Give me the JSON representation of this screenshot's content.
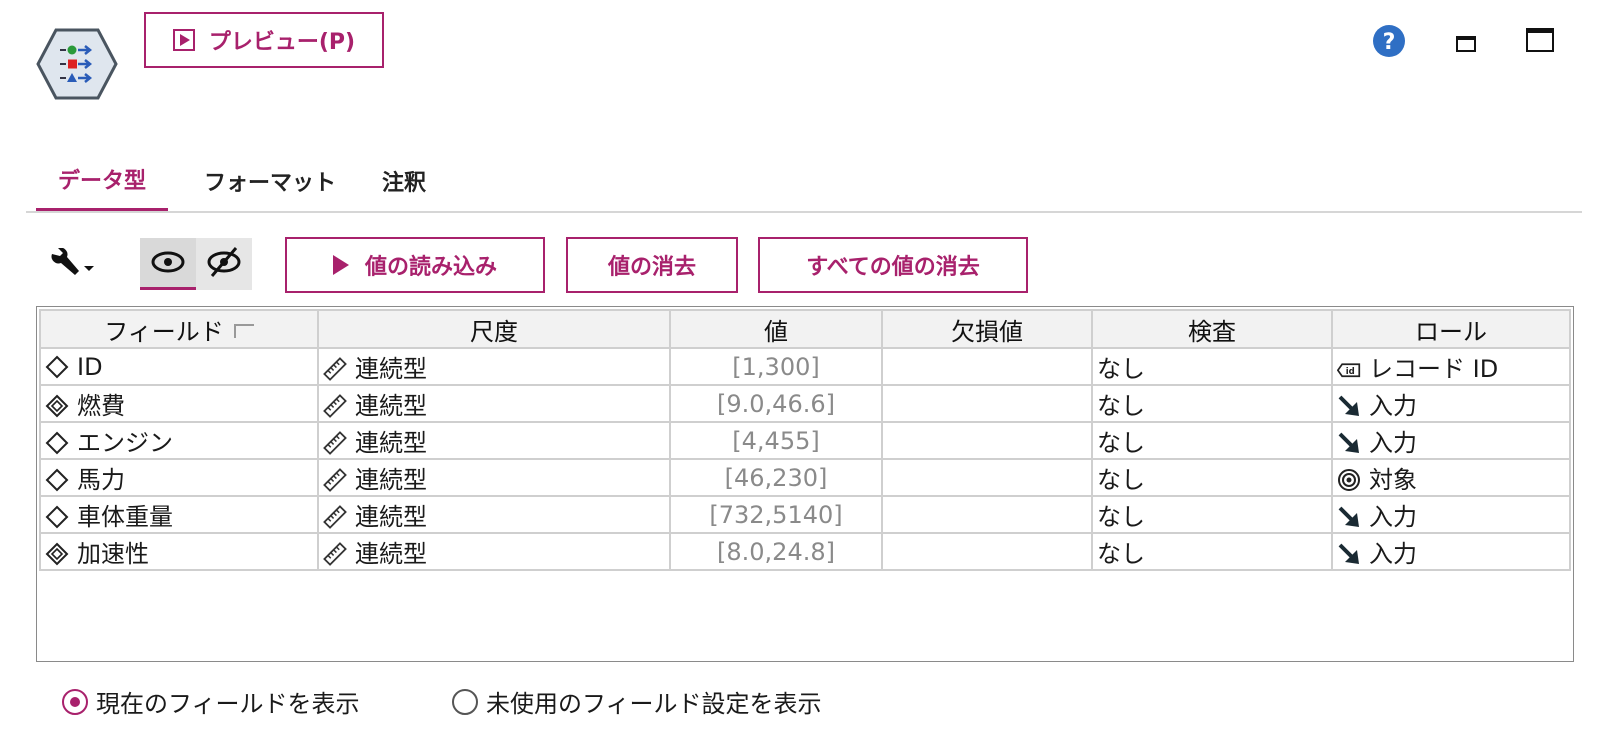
{
  "toolbar": {
    "preview_label": "プレビュー(P)"
  },
  "tabs": [
    {
      "label": "データ型",
      "active": true
    },
    {
      "label": "フォーマット",
      "active": false
    },
    {
      "label": "注釈",
      "active": false
    }
  ],
  "actions": {
    "read_values": "値の読み込み",
    "clear_values": "値の消去",
    "clear_all_values": "すべての値の消去"
  },
  "table": {
    "columns": [
      "フィールド",
      "尺度",
      "値",
      "欠損値",
      "検査",
      "ロール"
    ],
    "rows": [
      {
        "field": "ID",
        "field_icon": "diamond-icon",
        "measure": "連続型",
        "value": "[1,300]",
        "missing": "",
        "check": "なし",
        "role": "レコード ID",
        "role_icon": "record-id-icon"
      },
      {
        "field": "燃費",
        "field_icon": "double-diamond-icon",
        "measure": "連続型",
        "value": "[9.0,46.6]",
        "missing": "",
        "check": "なし",
        "role": "入力",
        "role_icon": "input-arrow-icon"
      },
      {
        "field": "エンジン",
        "field_icon": "diamond-icon",
        "measure": "連続型",
        "value": "[4,455]",
        "missing": "",
        "check": "なし",
        "role": "入力",
        "role_icon": "input-arrow-icon"
      },
      {
        "field": "馬力",
        "field_icon": "diamond-icon",
        "measure": "連続型",
        "value": "[46,230]",
        "missing": "",
        "check": "なし",
        "role": "対象",
        "role_icon": "target-icon"
      },
      {
        "field": "車体重量",
        "field_icon": "diamond-icon",
        "measure": "連続型",
        "value": "[732,5140]",
        "missing": "",
        "check": "なし",
        "role": "入力",
        "role_icon": "input-arrow-icon"
      },
      {
        "field": "加速性",
        "field_icon": "double-diamond-icon",
        "measure": "連続型",
        "value": "[8.0,24.8]",
        "missing": "",
        "check": "なし",
        "role": "入力",
        "role_icon": "input-arrow-icon"
      }
    ]
  },
  "view_options": {
    "current_fields": "現在のフィールドを表示",
    "unused_fields": "未使用のフィールド設定を表示",
    "selected": "current_fields"
  },
  "colors": {
    "accent": "#a8216c",
    "help": "#2f6fc4"
  }
}
